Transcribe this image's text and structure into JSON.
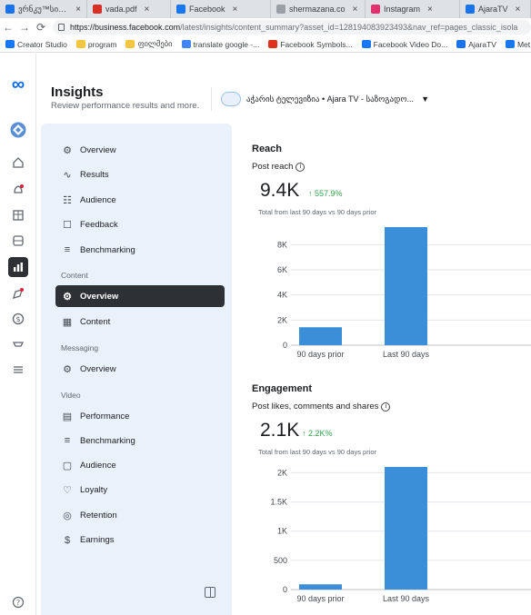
{
  "browser": {
    "tabs": [
      {
        "title": "ვრნკუ™სი - A",
        "icon_color": "#1a73e8",
        "close": "×"
      },
      {
        "title": "vada.pdf",
        "icon_color": "#d93025",
        "close": "×"
      },
      {
        "title": "Facebook",
        "icon_color": "#1877f2",
        "close": "×"
      },
      {
        "title": "shermazana.co",
        "icon_color": "#9aa0a6",
        "close": "×"
      },
      {
        "title": "Instagram",
        "icon_color": "#e1306c",
        "close": "×"
      },
      {
        "title": "AjaraTV",
        "icon_color": "#1a73e8",
        "close": "×"
      }
    ],
    "url_host": "https://business.facebook.com",
    "url_path": "/latest/insights/content_summary?asset_id=128194083923493&nav_ref=pages_classic_isola",
    "bookmarks": [
      {
        "label": "Creator Studio",
        "icon_color": "#1877f2"
      },
      {
        "label": "program",
        "icon_color": "#f4c542"
      },
      {
        "label": "ფილმები",
        "icon_color": "#f4c542"
      },
      {
        "label": "translate google -...",
        "icon_color": "#4285f4"
      },
      {
        "label": "Facebook Symbols...",
        "icon_color": "#e0301e"
      },
      {
        "label": "Facebook Video Do...",
        "icon_color": "#1877f2"
      },
      {
        "label": "AjaraTV",
        "icon_color": "#1a73e8"
      },
      {
        "label": "Met",
        "icon_color": "#1877f2"
      }
    ]
  },
  "header": {
    "title": "Insights",
    "subtitle": "Review performance results and more.",
    "account_name": "აჭარის ტელევიზია • Ajara TV - საზოგადო..."
  },
  "sidebar": {
    "items_top": [
      {
        "label": "Overview",
        "icon": "overview-icon"
      },
      {
        "label": "Results",
        "icon": "trend-icon"
      },
      {
        "label": "Audience",
        "icon": "audience-icon"
      },
      {
        "label": "Feedback",
        "icon": "feedback-icon"
      },
      {
        "label": "Benchmarking",
        "icon": "benchmark-icon"
      }
    ],
    "content_label": "Content",
    "content_items": [
      {
        "label": "Overview",
        "icon": "overview-icon"
      },
      {
        "label": "Content",
        "icon": "table-icon"
      }
    ],
    "messaging_label": "Messaging",
    "messaging_items": [
      {
        "label": "Overview",
        "icon": "overview-icon"
      }
    ],
    "video_label": "Video",
    "video_items": [
      {
        "label": "Performance",
        "icon": "performance-icon"
      },
      {
        "label": "Benchmarking",
        "icon": "benchmark-icon"
      },
      {
        "label": "Audience",
        "icon": "video-audience-icon"
      },
      {
        "label": "Loyalty",
        "icon": "loyalty-icon"
      },
      {
        "label": "Retention",
        "icon": "retention-icon"
      },
      {
        "label": "Earnings",
        "icon": "earnings-icon"
      }
    ]
  },
  "reach": {
    "title": "Reach",
    "subtitle": "Post reach",
    "value": "9.4K",
    "delta": "↑ 557.9%",
    "note": "Total from last 90 days vs 90 days prior"
  },
  "engagement": {
    "title": "Engagement",
    "subtitle": "Post likes, comments and shares",
    "value": "2.1K",
    "delta": "↑ 2.2K%",
    "note": "Total from last 90 days vs 90 days prior"
  },
  "colors": {
    "bar": "#3b8fd9",
    "accent_green": "#31a24c",
    "sidebar_bg": "#e9f1fa",
    "active_bg": "#2d3136"
  },
  "chart_data": [
    {
      "type": "bar",
      "categories": [
        "90 days prior",
        "Last 90 days"
      ],
      "values": [
        1430,
        9400
      ],
      "title": "",
      "xlabel": "",
      "ylabel": "",
      "yticks": [
        "0",
        "2K",
        "4K",
        "6K",
        "8K"
      ],
      "ytick_values": [
        0,
        2000,
        4000,
        6000,
        8000
      ],
      "ylim": [
        0,
        9400
      ],
      "grid": true
    },
    {
      "type": "bar",
      "categories": [
        "90 days prior",
        "Last 90 days"
      ],
      "values": [
        90,
        2100
      ],
      "title": "",
      "xlabel": "",
      "ylabel": "",
      "yticks": [
        "0",
        "500",
        "1K",
        "1.5K",
        "2K"
      ],
      "ytick_values": [
        0,
        500,
        1000,
        1500,
        2000
      ],
      "ylim": [
        0,
        2100
      ],
      "grid": true
    }
  ]
}
